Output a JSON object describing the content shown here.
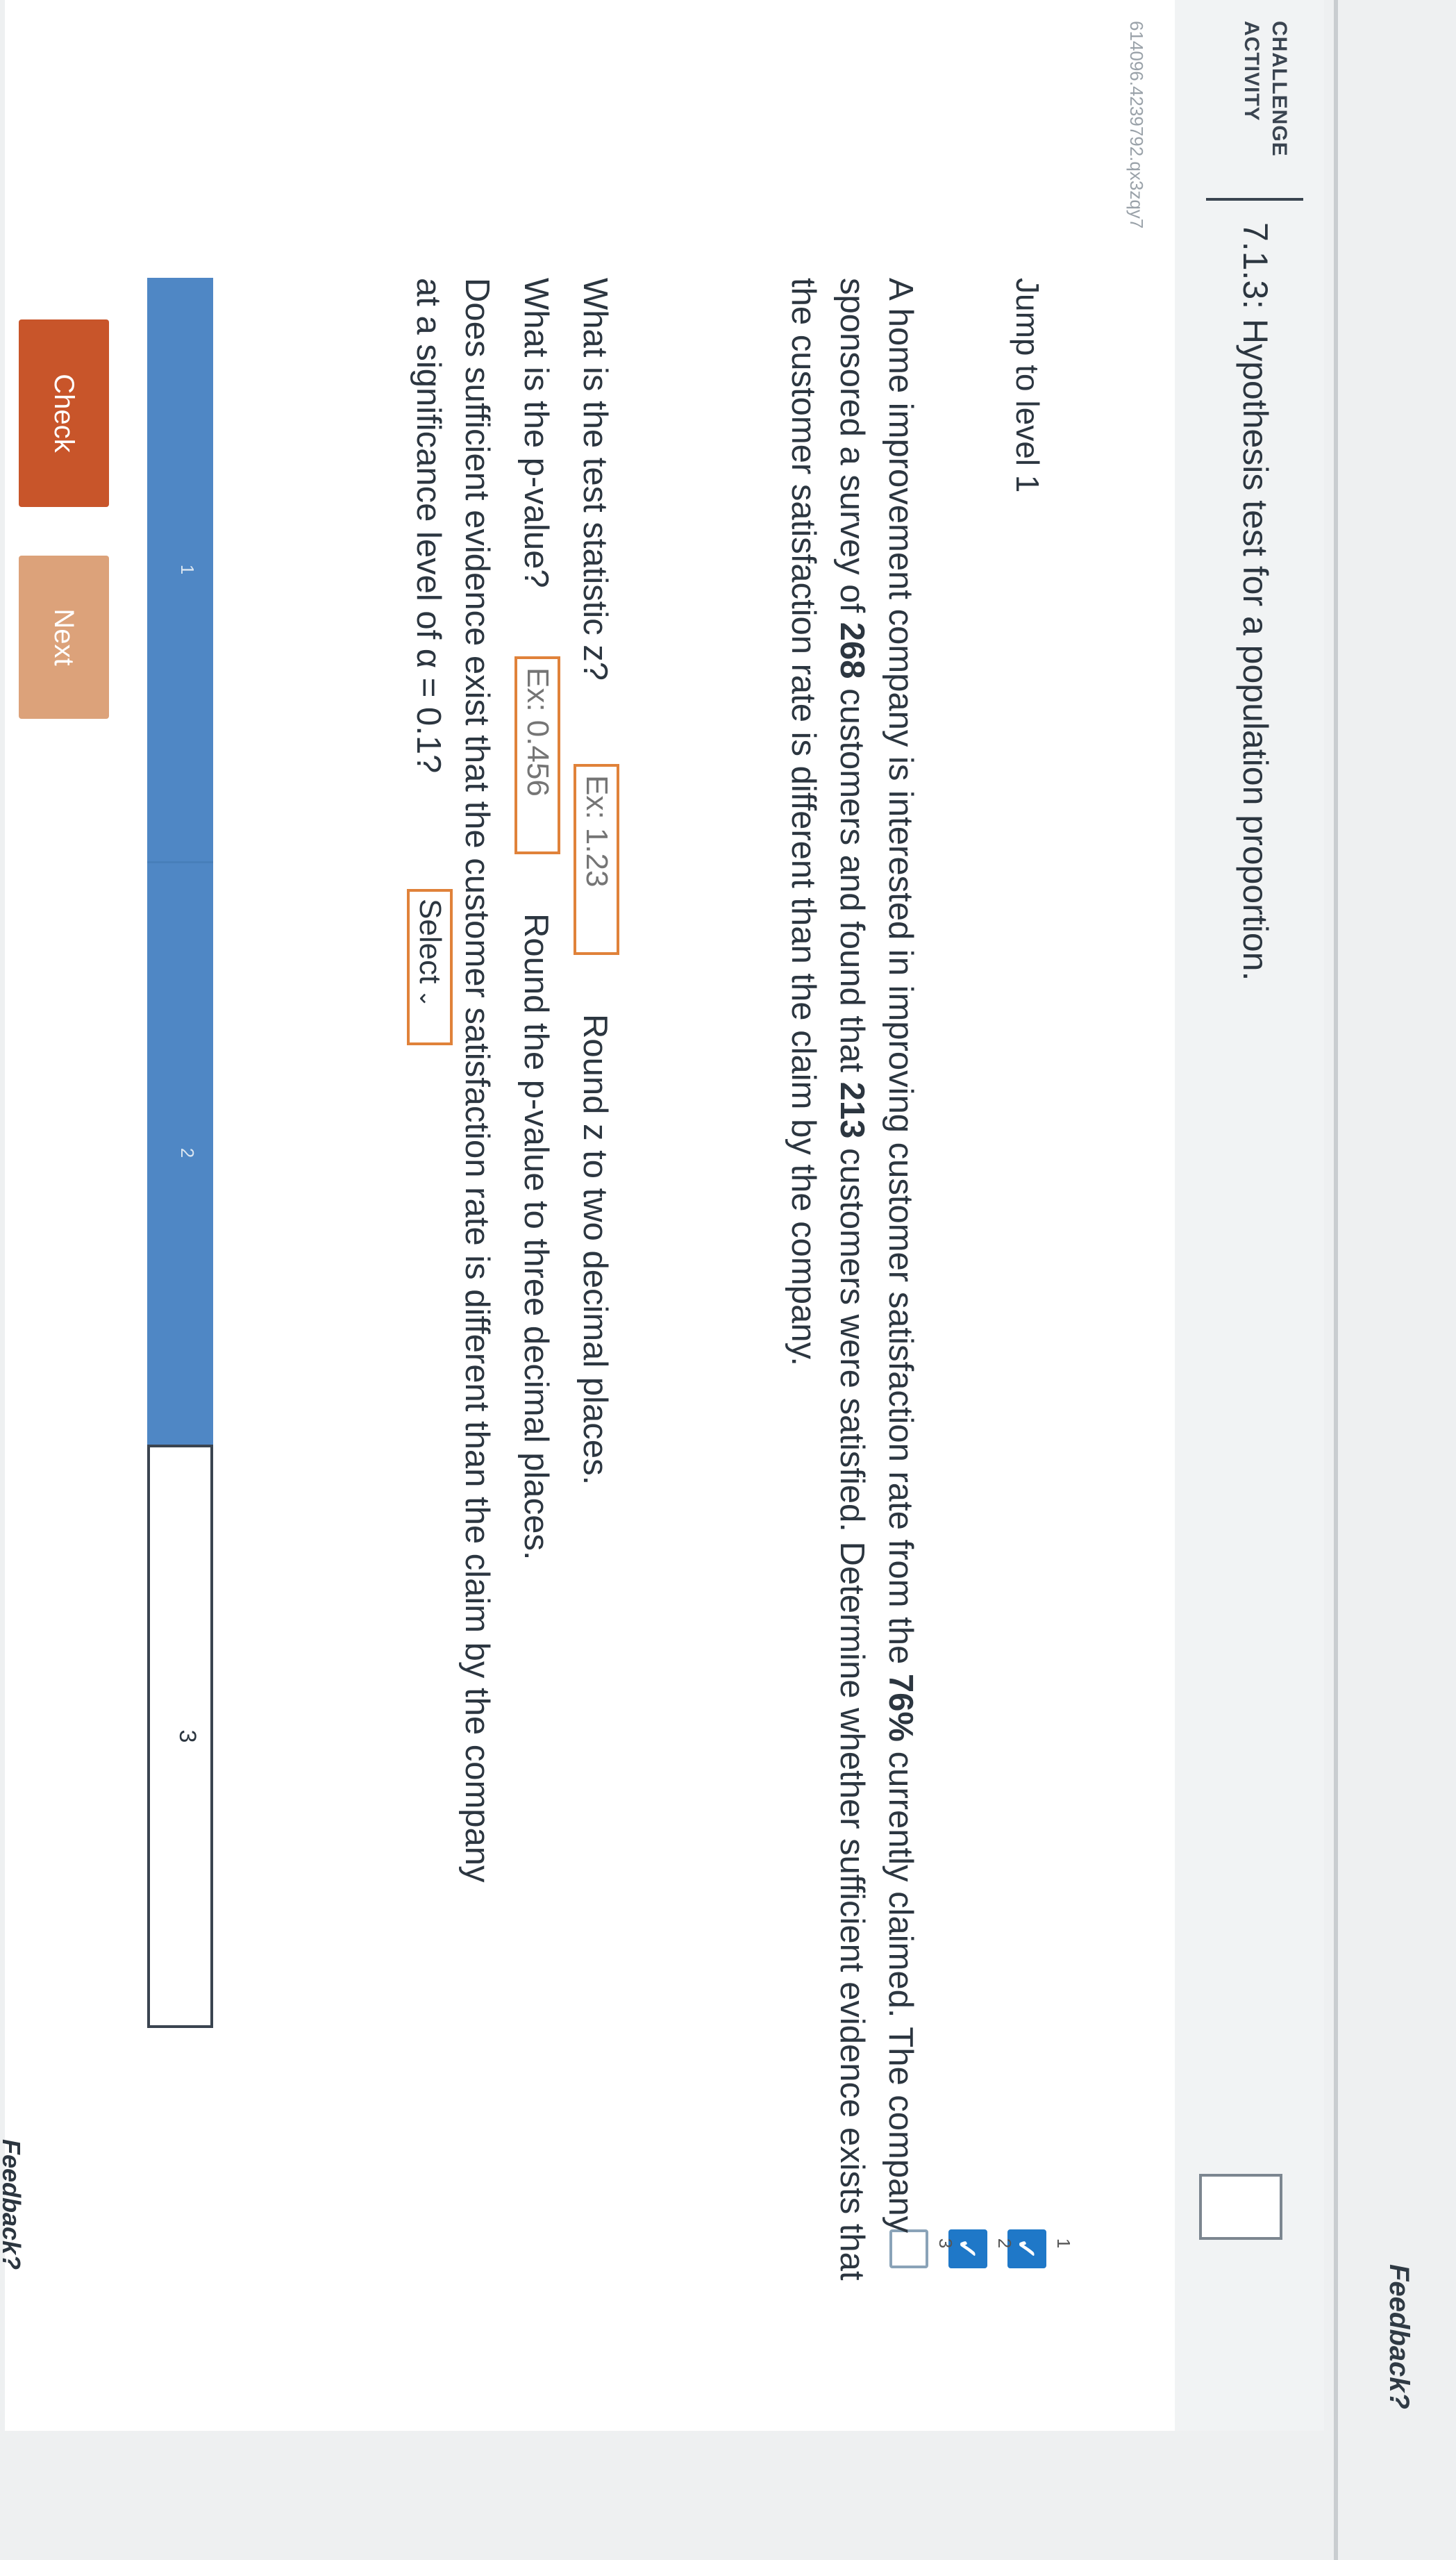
{
  "page": {
    "feedback_top": "Feedback?",
    "feedback_bottom": "Feedback?"
  },
  "header": {
    "badge_line1": "CHALLENGE",
    "badge_line2": "ACTIVITY",
    "title": "7.1.3: Hypothesis test for a population proportion.",
    "activity_id": "614096.4239792.qx3zqy7"
  },
  "levels": {
    "jump_label": "Jump to level 1",
    "items": [
      {
        "number": "1",
        "completed": true
      },
      {
        "number": "2",
        "completed": true
      },
      {
        "number": "3",
        "completed": false
      }
    ]
  },
  "problem": {
    "text_part1": "A home improvement company is interested in improving customer satisfaction rate from the ",
    "claim_rate": "76%",
    "text_part2": " currently claimed. The company sponsored a survey of ",
    "sample_size": "268",
    "text_part3": " customers and found that ",
    "satisfied": "213",
    "text_part4": " customers were satisfied. Determine whether sufficient evidence exists that the customer satisfaction rate is different than the claim by the company."
  },
  "questions": {
    "z_label": "What is the test statistic z?",
    "z_placeholder": "Ex: 1.23",
    "z_hint": "Round z to two decimal places.",
    "p_label": "What is the p-value?",
    "p_placeholder": "Ex: 0.456",
    "p_hint": "Round the p-value to three decimal places.",
    "evidence_label_line1": "Does sufficient evidence exist that the customer satisfaction rate is different than the claim by the company",
    "evidence_label_line2": "at a significance level of α = 0.1?",
    "select_value": "Select"
  },
  "progress": {
    "segments": [
      "1",
      "2",
      "3"
    ],
    "completed_segments": 2
  },
  "buttons": {
    "check": "Check",
    "next": "Next"
  },
  "colors": {
    "accent_orange": "#e0823a",
    "check_button": "#c8552a",
    "next_button": "#dca27a",
    "progress_fill": "#4f87c5",
    "level_done": "#1f78c8"
  }
}
